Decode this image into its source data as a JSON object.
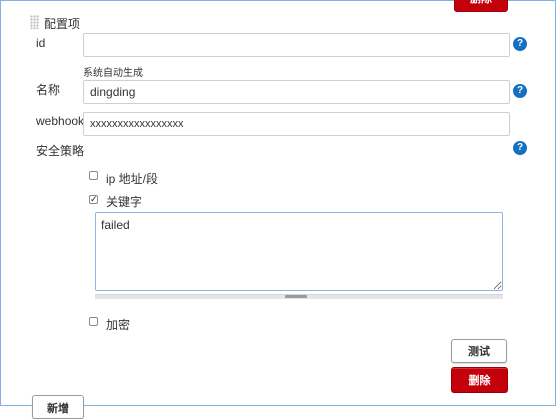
{
  "top": {
    "delete_label": "删除"
  },
  "section": {
    "title": "配置项"
  },
  "fields": {
    "id": {
      "label": "id",
      "value": "",
      "hint": "系统自动生成"
    },
    "name": {
      "label": "名称",
      "value": "dingding"
    },
    "webhook": {
      "label": "webhook",
      "value": "xxxxxxxxxxxxxxxxx"
    }
  },
  "security": {
    "label": "安全策略",
    "options": {
      "ip": {
        "label": "ip 地址/段",
        "checked": false
      },
      "keyword": {
        "label": "关键字",
        "checked": true,
        "value": "failed"
      },
      "sign": {
        "label": "加密",
        "checked": false
      }
    }
  },
  "actions": {
    "test_label": "测试",
    "delete_label": "删除"
  },
  "footer": {
    "add_label": "新增"
  },
  "colors": {
    "danger": "#c4000a",
    "help": "#1570c2",
    "frame": "#7fb1e2"
  }
}
